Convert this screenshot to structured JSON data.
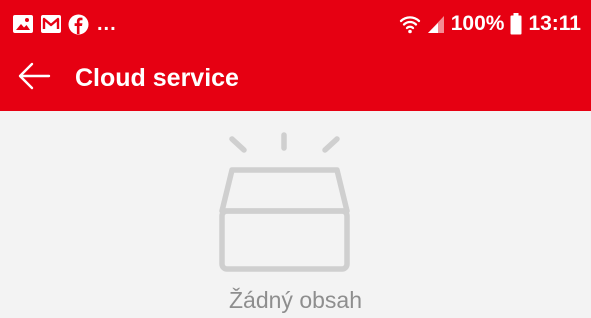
{
  "status_bar": {
    "notification_icons": [
      "gallery-icon",
      "mail-icon",
      "facebook-icon"
    ],
    "more_indicator": "...",
    "wifi_icon": "wifi-icon",
    "signal_icon": "signal-icon",
    "battery_percent": "100%",
    "battery_icon": "battery-icon",
    "time": "13:11"
  },
  "toolbar": {
    "back_icon": "back-arrow-icon",
    "title": "Cloud service"
  },
  "empty_state": {
    "illustration_icon": "empty-box-icon",
    "message": "Žádný obsah"
  },
  "colors": {
    "brand": "#e60012",
    "background": "#f3f3f3",
    "muted_text": "#8e8e8e",
    "illustration": "#cfcfcf"
  }
}
